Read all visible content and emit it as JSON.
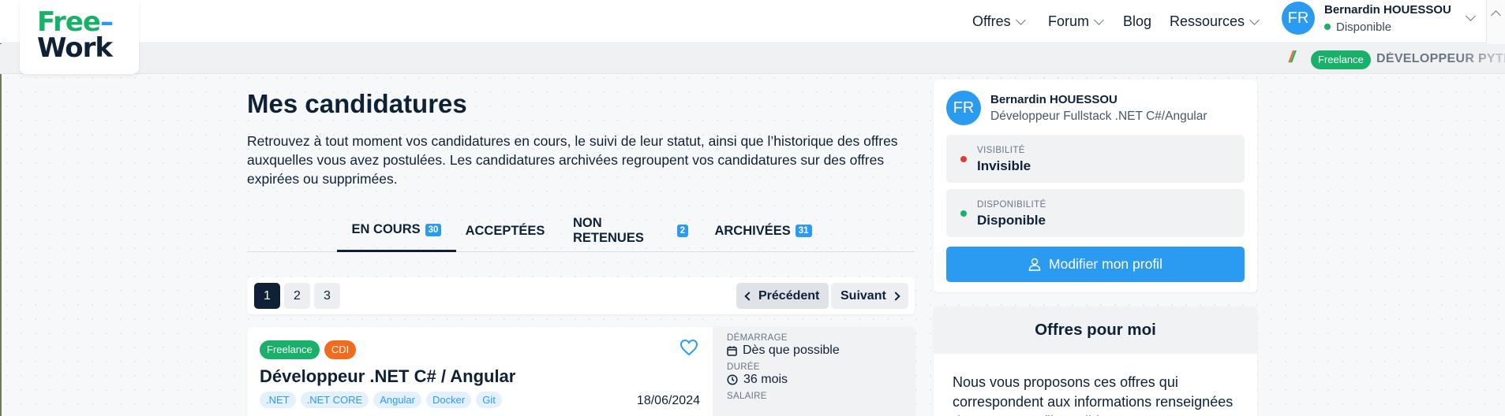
{
  "header": {
    "logo": {
      "line1": "Free",
      "line2": "Work"
    },
    "nav": [
      {
        "label": "Offres",
        "dropdown": true
      },
      {
        "label": "Forum",
        "dropdown": true
      },
      {
        "label": "Blog",
        "dropdown": false
      },
      {
        "label": "Ressources",
        "dropdown": true
      }
    ],
    "user": {
      "initials": "FR",
      "name": "Bernardin HOUESSOU",
      "status": "Disponible"
    }
  },
  "ticker": {
    "badge": "Freelance",
    "text": "DÉVELOPPEUR PYTHO"
  },
  "main": {
    "title": "Mes candidatures",
    "description": "Retrouvez à tout moment vos candidatures en cours, le suivi de leur statut, ainsi que l’historique des offres auxquelles vous avez postulées. Les candidatures archivées regroupent vos candidatures sur des offres expirées ou supprimées.",
    "tabs": [
      {
        "label": "EN COURS",
        "count": "30",
        "active": true
      },
      {
        "label": "ACCEPTÉES",
        "count": ""
      },
      {
        "label": "NON RETENUES",
        "count": "2"
      },
      {
        "label": "ARCHIVÉES",
        "count": "31"
      }
    ],
    "pagination": {
      "pages": [
        "1",
        "2",
        "3"
      ],
      "current": "1",
      "prev": "Précédent",
      "next": "Suivant"
    },
    "job": {
      "badges": [
        "Freelance",
        "CDI"
      ],
      "title": "Développeur .NET C# / Angular",
      "tags": [
        ".NET",
        ".NET CORE",
        "Angular",
        "Docker",
        "Git"
      ],
      "date": "18/06/2024",
      "start_label": "DÉMARRAGE",
      "start_value": "Dès que possible",
      "duration_label": "DURÉE",
      "duration_value": "36 mois",
      "salary_label": "SALAIRE"
    }
  },
  "sidebar": {
    "profile": {
      "initials": "FR",
      "name": "Bernardin HOUESSOU",
      "role": "Développeur Fullstack .NET C#/Angular",
      "visibility_label": "VISIBILITÉ",
      "visibility_value": "Invisible",
      "availability_label": "DISPONIBILITÉ",
      "availability_value": "Disponible",
      "edit_button": "Modifier mon profil"
    },
    "offers": {
      "title": "Offres pour moi",
      "text": "Nous vous proposons ces offres qui correspondent aux informations renseignées dans votre profil candidat"
    }
  },
  "colors": {
    "brand_blue": "#2b9bf2",
    "green": "#19b06a",
    "orange": "#f26a1b",
    "navy": "#0f2137",
    "red": "#e53935"
  }
}
